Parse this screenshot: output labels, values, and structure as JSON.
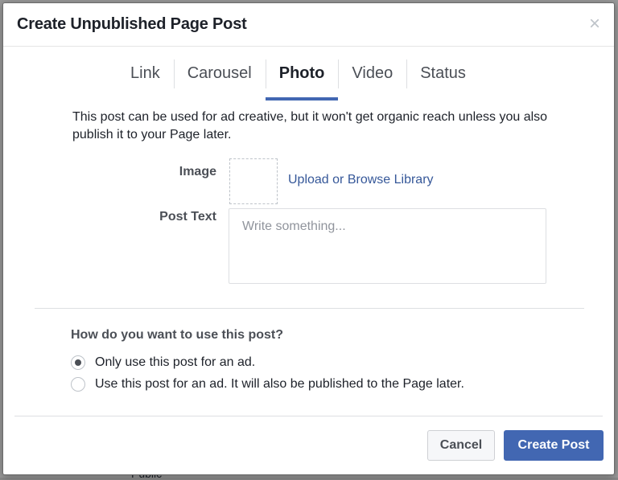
{
  "background": {
    "partial_text": "Public"
  },
  "dialog": {
    "title": "Create Unpublished Page Post",
    "close_icon": "close-icon"
  },
  "tabs": [
    {
      "label": "Link",
      "active": false
    },
    {
      "label": "Carousel",
      "active": false
    },
    {
      "label": "Photo",
      "active": true
    },
    {
      "label": "Video",
      "active": false
    },
    {
      "label": "Status",
      "active": false
    }
  ],
  "intro_text": "This post can be used for ad creative, but it won't get organic reach unless you also publish it to your Page later.",
  "image_field": {
    "label": "Image",
    "upload_link": "Upload or Browse Library"
  },
  "post_text_field": {
    "label": "Post Text",
    "placeholder": "Write something...",
    "value": ""
  },
  "usage": {
    "question": "How do you want to use this post?",
    "options": [
      {
        "label": "Only use this post for an ad.",
        "selected": true
      },
      {
        "label": "Use this post for an ad. It will also be published to the Page later.",
        "selected": false
      }
    ]
  },
  "footer": {
    "cancel_label": "Cancel",
    "create_label": "Create Post"
  },
  "colors": {
    "accent": "#4267b2",
    "link": "#365899"
  }
}
